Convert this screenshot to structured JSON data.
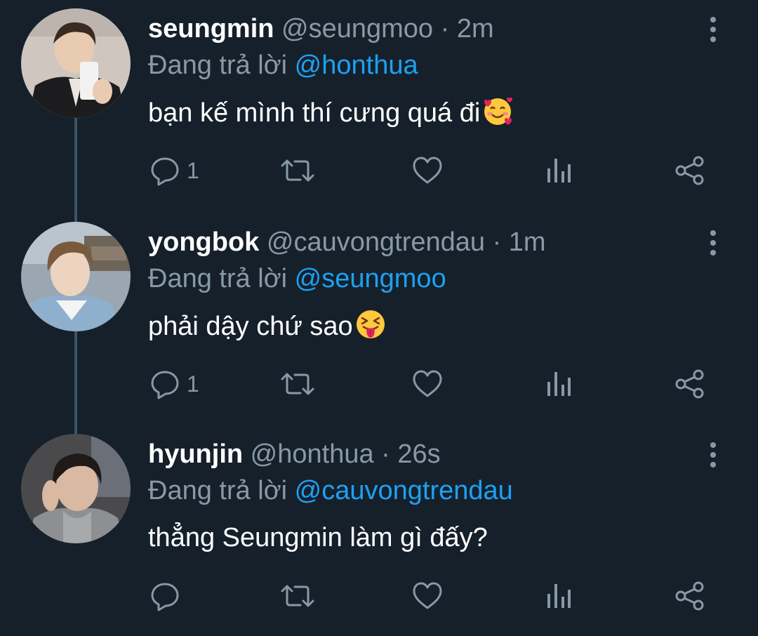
{
  "colors": {
    "background": "#15202b",
    "text_primary": "#ffffff",
    "text_secondary": "#8899a6",
    "mention": "#1da1f2",
    "thread_line": "#3d5466"
  },
  "icons": {
    "reply": "reply-icon",
    "retweet": "retweet-icon",
    "like": "heart-icon",
    "analytics": "analytics-icon",
    "share": "share-icon",
    "more": "more-vertical-icon"
  },
  "tweets": [
    {
      "name": "seungmin",
      "handle": "@seungmoo",
      "separator": "·",
      "time": "2m",
      "reply_prefix": "Đang trả lời",
      "reply_to": "@honthua",
      "text": "bạn kế mình thí cưng quá đi",
      "emoji": "smiling-face-with-hearts",
      "reply_count": "1"
    },
    {
      "name": "yongbok",
      "handle": "@cauvongtrendau",
      "separator": "·",
      "time": "1m",
      "reply_prefix": "Đang trả lời",
      "reply_to": "@seungmoo",
      "text": "phải dậy chứ sao",
      "emoji": "squinting-face-with-tongue",
      "reply_count": "1"
    },
    {
      "name": "hyunjin",
      "handle": "@honthua",
      "separator": "·",
      "time": "26s",
      "reply_prefix": "Đang trả lời",
      "reply_to": "@cauvongtrendau",
      "text": "thẳng Seungmin làm gì đấy?",
      "emoji": "",
      "reply_count": ""
    }
  ]
}
